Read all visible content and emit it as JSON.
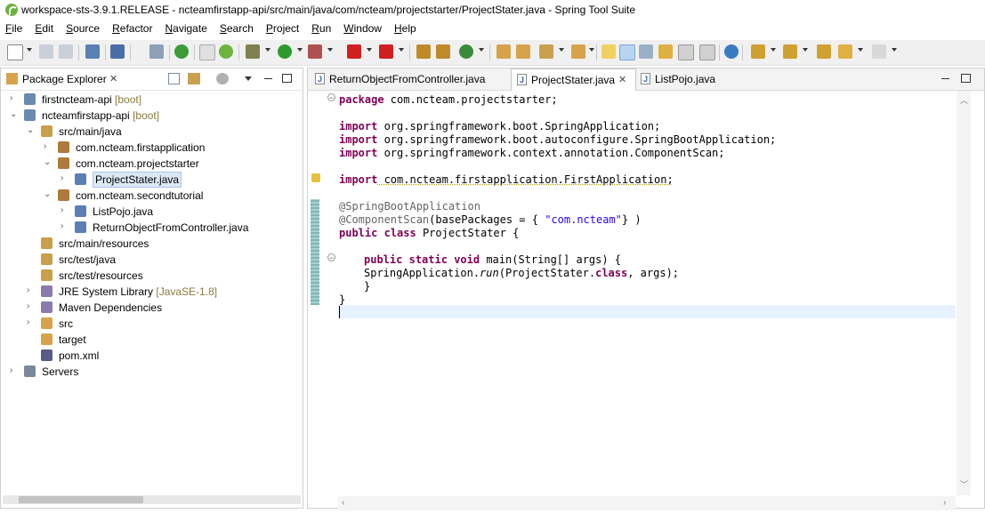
{
  "window": {
    "title": "workspace-sts-3.9.1.RELEASE - ncteamfirstapp-api/src/main/java/com/ncteam/projectstarter/ProjectStater.java - Spring Tool Suite"
  },
  "menu": [
    "File",
    "Edit",
    "Source",
    "Refactor",
    "Navigate",
    "Search",
    "Project",
    "Run",
    "Window",
    "Help"
  ],
  "package_explorer": {
    "title": "Package Explorer",
    "close": "✕",
    "tree": [
      {
        "label": "firstncteam-api",
        "decoration": "[boot]",
        "level": 0,
        "twisty": "›"
      },
      {
        "label": "ncteamfirstapp-api",
        "decoration": "[boot]",
        "level": 0,
        "twisty": "⌄"
      },
      {
        "label": "src/main/java",
        "decoration": "",
        "level": 1,
        "twisty": "⌄"
      },
      {
        "label": "com.ncteam.firstapplication",
        "decoration": "",
        "level": 2,
        "twisty": "›"
      },
      {
        "label": "com.ncteam.projectstarter",
        "decoration": "",
        "level": 2,
        "twisty": "⌄"
      },
      {
        "label": "ProjectStater.java",
        "decoration": "",
        "level": 3,
        "twisty": "›",
        "selected": true
      },
      {
        "label": "com.ncteam.secondtutorial",
        "decoration": "",
        "level": 2,
        "twisty": "⌄"
      },
      {
        "label": "ListPojo.java",
        "decoration": "",
        "level": 3,
        "twisty": "›"
      },
      {
        "label": "ReturnObjectFromController.java",
        "decoration": "",
        "level": 3,
        "twisty": "›"
      },
      {
        "label": "src/main/resources",
        "decoration": "",
        "level": 1,
        "twisty": ""
      },
      {
        "label": "src/test/java",
        "decoration": "",
        "level": 1,
        "twisty": ""
      },
      {
        "label": "src/test/resources",
        "decoration": "",
        "level": 1,
        "twisty": ""
      },
      {
        "label": "JRE System Library",
        "decoration": "[JavaSE-1.8]",
        "level": 1,
        "twisty": "›"
      },
      {
        "label": "Maven Dependencies",
        "decoration": "",
        "level": 1,
        "twisty": "›"
      },
      {
        "label": "src",
        "decoration": "",
        "level": 1,
        "twisty": "›"
      },
      {
        "label": "target",
        "decoration": "",
        "level": 1,
        "twisty": ""
      },
      {
        "label": "pom.xml",
        "decoration": "",
        "level": 1,
        "twisty": ""
      },
      {
        "label": "Servers",
        "decoration": "",
        "level": 0,
        "twisty": "›"
      }
    ]
  },
  "editor": {
    "tabs": [
      {
        "label": "ReturnObjectFromController.java",
        "active": false
      },
      {
        "label": "ProjectStater.java",
        "active": true,
        "close": "✕"
      },
      {
        "label": "ListPojo.java",
        "active": false
      }
    ],
    "code": {
      "l1_kw": "package",
      "l1_rest": " com.ncteam.projectstarter;",
      "l3_kw": "import",
      "l3_rest": " org.springframework.boot.SpringApplication;",
      "l4_kw": "import",
      "l4_rest": " org.springframework.boot.autoconfigure.SpringBootApplication;",
      "l5_kw": "import",
      "l5_rest": " org.springframework.context.annotation.ComponentScan;",
      "l7_kw": "import",
      "l7_rest": " com.ncteam.firstapplication.FirstApplication;",
      "l9_an": "@SpringBootApplication",
      "l10_an": "@ComponentScan",
      "l10_mid": "(basePackages = { ",
      "l10_str": "\"com.ncteam\"",
      "l10_end": "} )",
      "l11_kw1": "public",
      "l11_kw2": "class",
      "l11_rest": " ProjectStater {",
      "l13_kw1": "public",
      "l13_kw2": "static",
      "l13_kw3": "void",
      "l13_rest": " main(String[] args) {",
      "l14_a": "SpringApplication.",
      "l14_it": "run",
      "l14_b": "(ProjectStater.",
      "l14_kw": "class",
      "l14_c": ", args);",
      "l15": "}",
      "l16": "}"
    }
  },
  "icons": {
    "accent_green": "#6db33f",
    "keyword_color": "#7f0055",
    "string_color": "#2a00ff",
    "annotation_color": "#646464"
  }
}
